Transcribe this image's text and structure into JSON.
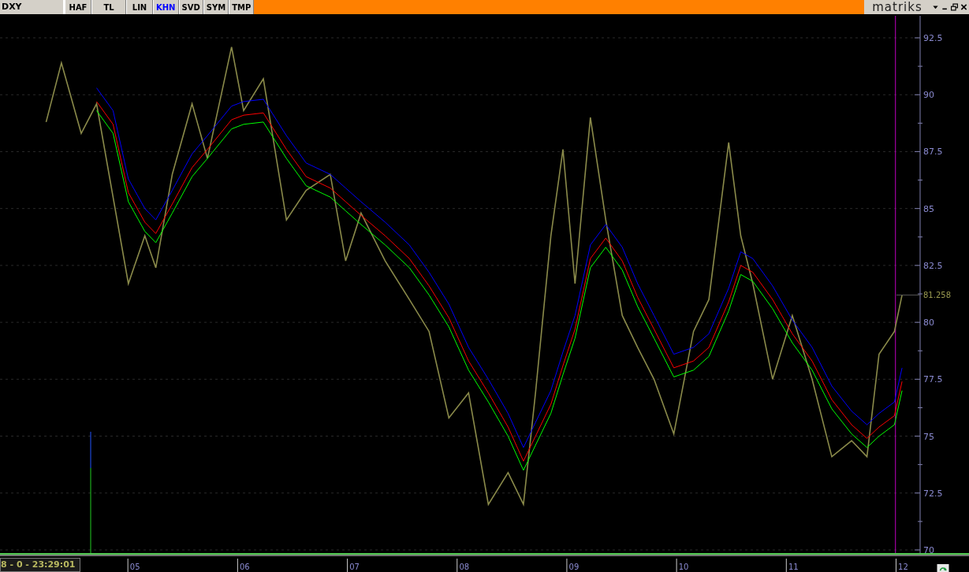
{
  "toolbar": {
    "symbol": "DXY",
    "tabs": [
      {
        "label": "HAF",
        "selected": false
      },
      {
        "label": "TL",
        "selected": false
      },
      {
        "label": "LIN",
        "selected": false
      },
      {
        "label": "KHN",
        "selected": true
      },
      {
        "label": "SVD",
        "selected": false
      },
      {
        "label": "SYM",
        "selected": false
      },
      {
        "label": "TMP",
        "selected": false
      }
    ],
    "brand": "matriks"
  },
  "chart": {
    "chart_data": {
      "type": "line",
      "grid": true,
      "x": [
        4.19,
        4.33,
        4.51,
        4.65,
        4.8,
        4.94,
        5.09,
        5.19,
        5.34,
        5.52,
        5.66,
        5.88,
        5.99,
        6.17,
        6.38,
        6.56,
        6.78,
        6.92,
        7.06,
        7.28,
        7.5,
        7.68,
        7.86,
        8.04,
        8.22,
        8.4,
        8.54,
        8.65,
        8.79,
        8.9,
        9.01,
        9.15,
        9.29,
        9.44,
        9.58,
        9.73,
        9.91,
        10.09,
        10.23,
        10.41,
        10.52,
        10.63,
        10.81,
        10.99,
        11.17,
        11.35,
        11.53,
        11.67,
        11.78,
        11.92,
        11.99
      ],
      "series": [
        {
          "color": "#8a8a4a",
          "values": [
            88.8,
            91.4,
            88.3,
            89.6,
            85.5,
            81.7,
            83.8,
            82.4,
            86.5,
            89.6,
            87.2,
            92.1,
            89.3,
            90.7,
            84.5,
            85.8,
            86.5,
            82.7,
            84.8,
            82.7,
            81.0,
            79.6,
            75.8,
            76.9,
            72.0,
            73.4,
            72.0,
            76.9,
            83.8,
            87.6,
            81.7,
            89.0,
            84.5,
            80.3,
            78.9,
            77.5,
            75.1,
            79.6,
            81.0,
            87.9,
            83.8,
            81.7,
            77.5,
            80.3,
            77.5,
            74.1,
            74.8,
            74.1,
            78.6,
            79.6,
            81.2
          ]
        },
        {
          "color": "#0000ff",
          "values": [
            null,
            null,
            null,
            90.3,
            89.3,
            86.3,
            85.0,
            84.5,
            85.8,
            87.4,
            88.2,
            89.5,
            89.7,
            89.8,
            88.2,
            87.0,
            86.5,
            85.9,
            85.3,
            84.4,
            83.4,
            82.2,
            80.8,
            78.9,
            77.5,
            76.0,
            74.5,
            75.6,
            77.0,
            78.7,
            80.3,
            83.4,
            84.3,
            83.3,
            81.7,
            80.3,
            78.6,
            78.9,
            79.5,
            81.5,
            83.1,
            82.8,
            81.6,
            80.1,
            78.9,
            77.2,
            76.1,
            75.5,
            76.0,
            76.5,
            78.0
          ]
        },
        {
          "color": "#ff0000",
          "values": [
            null,
            null,
            null,
            89.7,
            88.7,
            85.7,
            84.4,
            83.9,
            85.2,
            86.8,
            87.6,
            88.9,
            89.1,
            89.2,
            87.6,
            86.4,
            85.9,
            85.3,
            84.7,
            83.8,
            82.8,
            81.6,
            80.2,
            78.3,
            76.9,
            75.4,
            73.9,
            75.0,
            76.4,
            78.1,
            79.7,
            82.8,
            83.7,
            82.7,
            81.1,
            79.7,
            78.0,
            78.3,
            78.9,
            80.9,
            82.5,
            82.2,
            81.0,
            79.5,
            78.3,
            76.6,
            75.5,
            74.9,
            75.4,
            75.9,
            77.4
          ]
        },
        {
          "color": "#00ff00",
          "values": [
            null,
            null,
            null,
            89.3,
            88.3,
            85.3,
            84.0,
            83.5,
            84.8,
            86.4,
            87.2,
            88.5,
            88.7,
            88.8,
            87.2,
            86.0,
            85.5,
            84.9,
            84.3,
            83.4,
            82.4,
            81.2,
            79.8,
            77.9,
            76.5,
            75.0,
            73.5,
            74.6,
            76.0,
            77.7,
            79.3,
            82.4,
            83.3,
            82.3,
            80.7,
            79.3,
            77.6,
            77.9,
            78.5,
            80.5,
            82.1,
            81.8,
            80.6,
            79.1,
            77.9,
            76.2,
            75.1,
            74.5,
            75.0,
            75.5,
            77.0
          ]
        }
      ],
      "xlim": [
        3.77,
        12.6
      ],
      "ylim": [
        70,
        92.5
      ],
      "xticks": [
        {
          "value": 5,
          "label": "05"
        },
        {
          "value": 6,
          "label": "06"
        },
        {
          "value": 7,
          "label": "07"
        },
        {
          "value": 8,
          "label": "08"
        },
        {
          "value": 9,
          "label": "09"
        },
        {
          "value": 10,
          "label": "10"
        },
        {
          "value": 11,
          "label": "11"
        },
        {
          "value": 12,
          "label": "12"
        }
      ],
      "yticks": [
        {
          "value": 70,
          "label": "70"
        },
        {
          "value": 72.5,
          "label": "72.5"
        },
        {
          "value": 75,
          "label": "75"
        },
        {
          "value": 77.5,
          "label": "77.5"
        },
        {
          "value": 80,
          "label": "80"
        },
        {
          "value": 82.5,
          "label": "82.5"
        },
        {
          "value": 85,
          "label": "85"
        },
        {
          "value": 87.5,
          "label": "87.5"
        },
        {
          "value": 90,
          "label": "90"
        },
        {
          "value": 92.5,
          "label": "92.5"
        }
      ],
      "ref_lines": [
        {
          "axis": "x",
          "value": 11.93,
          "color": "#c000c0"
        }
      ]
    },
    "last_price": "81.258",
    "timestamp": "8 - 0 - 23:29:01"
  }
}
